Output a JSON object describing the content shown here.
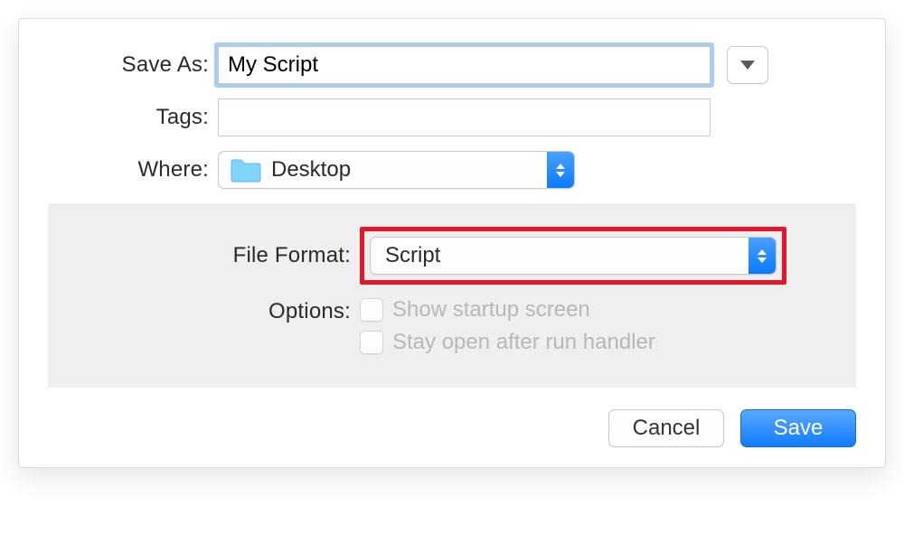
{
  "labels": {
    "saveAs": "Save As:",
    "tags": "Tags:",
    "where": "Where:",
    "fileFormat": "File Format:",
    "options": "Options:"
  },
  "saveAs": {
    "value": "My Script",
    "placeholder": ""
  },
  "tags": {
    "value": "",
    "placeholder": ""
  },
  "where": {
    "selected": "Desktop"
  },
  "fileFormat": {
    "selected": "Script"
  },
  "options": {
    "showStartup": "Show startup screen",
    "stayOpen": "Stay open after run handler"
  },
  "buttons": {
    "cancel": "Cancel",
    "save": "Save"
  }
}
